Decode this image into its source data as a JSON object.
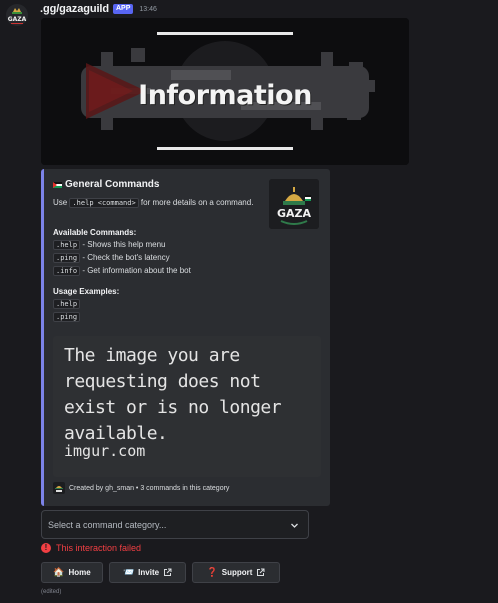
{
  "message": {
    "username": ".gg/gazaguild",
    "badge": "APP",
    "timestamp": "13:46",
    "avatar_text": "GAZA",
    "edited_label": "(edited)"
  },
  "banner": {
    "title": "Information"
  },
  "embed": {
    "title": "General Commands",
    "accent_color": "#7c83e8",
    "thumbnail_text": "GAZA",
    "description_prefix": "Use",
    "description_code": ".help <command>",
    "description_suffix": "for more details on a command.",
    "available_heading": "Available Commands:",
    "commands": [
      {
        "code": ".help",
        "text": "- Shows this help menu"
      },
      {
        "code": ".ping",
        "text": "- Check the bot's latency"
      },
      {
        "code": ".info",
        "text": "- Get information about the bot"
      }
    ],
    "examples_heading": "Usage Examples:",
    "examples": [
      ".help",
      ".ping"
    ],
    "image_missing_text": "The image you are requesting does not exist or is no longer available.",
    "image_missing_domain": "imgur.com",
    "footer": "Created by gh_sman • 3 commands in this category"
  },
  "select": {
    "placeholder": "Select a command category..."
  },
  "error": {
    "text": "This interaction failed"
  },
  "buttons": {
    "home": {
      "emoji": "🏠",
      "label": "Home"
    },
    "invite": {
      "emoji": "📨",
      "label": "Invite"
    },
    "support": {
      "emoji": "❓",
      "label": "Support"
    }
  }
}
